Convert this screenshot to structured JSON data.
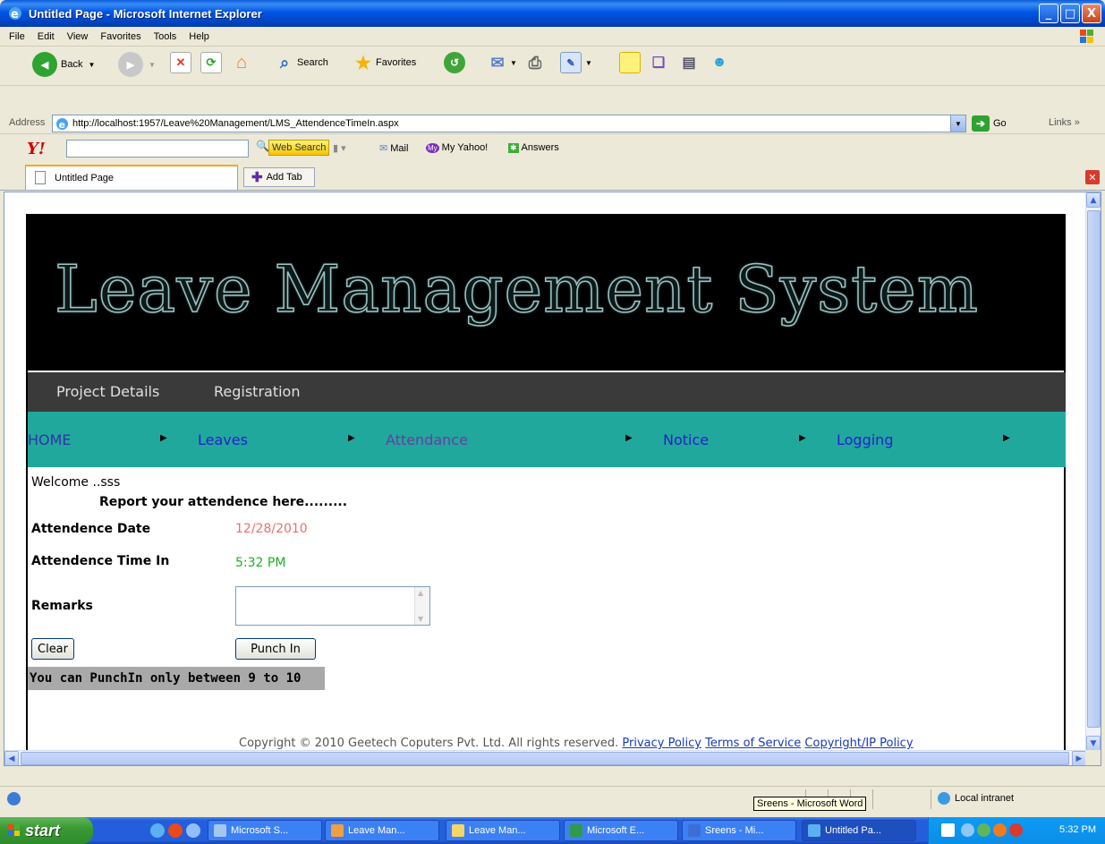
{
  "window": {
    "title": "Untitled Page - Microsoft Internet Explorer",
    "controls": [
      "_",
      "□",
      "X"
    ]
  },
  "menu": [
    "File",
    "Edit",
    "View",
    "Favorites",
    "Tools",
    "Help"
  ],
  "toolbar": {
    "back_label": "Back",
    "search_label": "Search",
    "favorites_label": "Favorites"
  },
  "address": {
    "label": "Address",
    "url": "http://localhost:1957/Leave%20Management/LMS_AttendenceTimeIn.aspx",
    "go_label": "Go",
    "links_label": "Links"
  },
  "yahoo": {
    "logo": "Y!",
    "search_value": "",
    "web_search_label": "Web Search",
    "mail_label": "Mail",
    "my_yahoo_label": "My Yahoo!",
    "answers_label": "Answers"
  },
  "tabs": {
    "active_label": "Untitled Page",
    "add_tab_label": "Add Tab"
  },
  "page": {
    "banner_title": "Leave Management System",
    "top_nav": [
      "Project Details",
      "Registration"
    ],
    "main_nav": [
      "HOME",
      "Leaves",
      "Attendance",
      "Notice",
      "Logging"
    ],
    "welcome": "Welcome ..sss",
    "report_heading": "Report your attendence here.........",
    "date_label": "Attendence Date",
    "date_value": "12/28/2010",
    "time_label": "Attendence Time In",
    "time_value": "5:32 PM",
    "remarks_label": "Remarks",
    "remarks_value": "",
    "clear_label": "Clear",
    "punch_label": "Punch In",
    "warning": "You can PunchIn only between 9 to 10",
    "footer_text": "Copyright © 2010 Geetech Coputers Pvt. Ltd. All rights reserved.",
    "footer_links": [
      "Privacy Policy",
      "Terms of Service",
      "Copyright/IP Policy"
    ]
  },
  "status": {
    "zone_label": "Local intranet",
    "tooltip": "Sreens - Microsoft Word"
  },
  "taskbar": {
    "start_label": "start",
    "tasks": [
      "Microsoft S...",
      "Leave Man...",
      "Leave Man...",
      "Microsoft E...",
      "Sreens - Mi...",
      "Untitled Pa..."
    ],
    "clock": "5:32 PM"
  },
  "colors": {
    "nav_gray": "#3a3a3a",
    "nav_teal": "#21a89c",
    "date_color": "#e87070",
    "time_color": "#20b020",
    "warning_bg": "#a9a9a9"
  }
}
